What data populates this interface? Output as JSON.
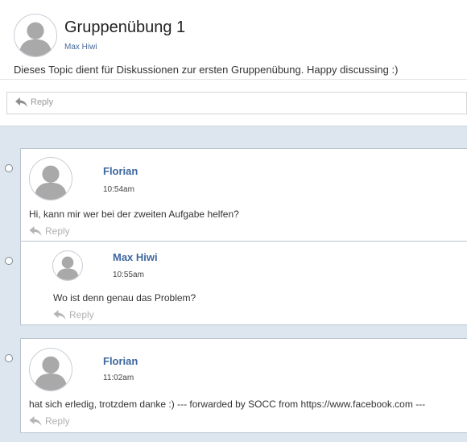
{
  "topic": {
    "title": "Gruppenübung 1",
    "author": "Max Hiwi",
    "description": "Dieses Topic dient für Diskussionen zur ersten Gruppenübung. Happy discussing :)",
    "reply_label": "Reply"
  },
  "posts": [
    {
      "author": "Florian",
      "time": "10:54am",
      "text": "Hi, kann mir wer bei der zweiten Aufgabe helfen?",
      "reply_label": "Reply"
    },
    {
      "author": "Max Hiwi",
      "time": "10:55am",
      "text": "Wo ist denn genau das Problem?",
      "reply_label": "Reply"
    },
    {
      "author": "Florian",
      "time": "11:02am",
      "text": "hat sich erledig, trotzdem danke :) --- forwarded by SOCC from https://www.facebook.com ---",
      "reply_label": "Reply"
    }
  ],
  "icons": {
    "avatar": "user-silhouette-icon",
    "reply": "reply-arrow-icon",
    "bullet": "thread-bullet-icon"
  },
  "colors": {
    "accent": "#3e679f",
    "thread_background": "#dde6ee",
    "muted": "#999999"
  }
}
